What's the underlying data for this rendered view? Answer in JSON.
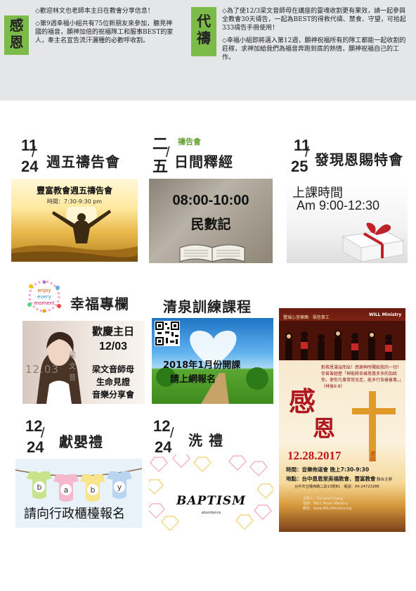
{
  "thanks": {
    "tag": "感恩",
    "items": [
      "◇歡迎林文也老師本主日在教會分享信息！",
      "◇第9週幸福小組共有75位新朋友來參加，聽見神國的福音，願神加倍的祝福隊工和服事BEST的家人，奉主名宣告流汗灑種的必歡呼收割。"
    ]
  },
  "prayer": {
    "tag": "代禱",
    "items": [
      "◇為了使12/3梁文音師母在講座的靈魂收割更有果效，請一起參與全教會30天禱告，一起為BEST的得救代禱、禁食、守望，可拾起333禱告手冊使用！",
      "◇幸福小組即將邁入第12週，願神祝福所有的隊工都能一起收割的莊稼，求神加給我們為福音奔跑到底的熱情，願神祝福自己的工作。"
    ]
  },
  "events": {
    "friday": {
      "m": "11",
      "d": "24",
      "title": "週五禱告會",
      "img_title": "豐富教會週五禱告會",
      "img_time": "時間：7:30-9:30 pm"
    },
    "daily": {
      "m": "二",
      "d": "五",
      "above": "禱告會",
      "title": "日間釋經",
      "img_time": "08:00-10:00",
      "img_book": "民數記"
    },
    "grace": {
      "m": "11",
      "d": "25",
      "title": "發現恩賜特會",
      "img_line1": "上課時間",
      "img_line2": "Am 9:00-12:30"
    },
    "happy": {
      "title": "幸福專欄",
      "badge_lines": [
        "enjoy",
        "every",
        "moment"
      ],
      "img_line1": "歡慶主日",
      "img_line2": "12/03",
      "img_line3": "梁文音師母",
      "img_line4": "生命見證",
      "img_line5": "音樂分享會",
      "img_side": "梁文音",
      "img_num": "12.03"
    },
    "spring": {
      "title": "清泉訓練課程",
      "img_line1": "2018年1月份開課",
      "img_line2": "請上網報名"
    },
    "dedication": {
      "m": "12",
      "d": "24",
      "title": "獻嬰禮",
      "banner": "請向行政櫃檯報名",
      "baby_letters": [
        "b",
        "a",
        "b",
        "y"
      ]
    },
    "baptism": {
      "m": "12",
      "d": "24",
      "title": "洗 禮",
      "word": "BAPTISM",
      "sub": "abundance"
    },
    "poster": {
      "top": "豐城心音樂團 · 福音事工",
      "logo": "WILL Ministry",
      "quote": "對救恩滿溢而出！感謝神所賜給我的一切！你曾曾經歷「神能將各樣恩惠多多的加給你，使你凡事常常充足，能多行各樣善事。」（林後9:8）",
      "calligraphy": [
        "感",
        "恩"
      ],
      "date": "12.28.2017",
      "weekday": "週四",
      "time_label": "時間：",
      "time": "音樂佈道會 晚上7:30-9:30",
      "place_label": "地點：",
      "place": "台中恩恩堂美福教會、豐富教會",
      "host": "聯合主辦",
      "addr": "台中市五權西路二段13號B1 · 電話：04-24723286",
      "credits": [
        "主辦人：Richard Chang",
        "協辦：WILL Music Ministry",
        "網址：www.WILLMinistry.org"
      ]
    }
  }
}
